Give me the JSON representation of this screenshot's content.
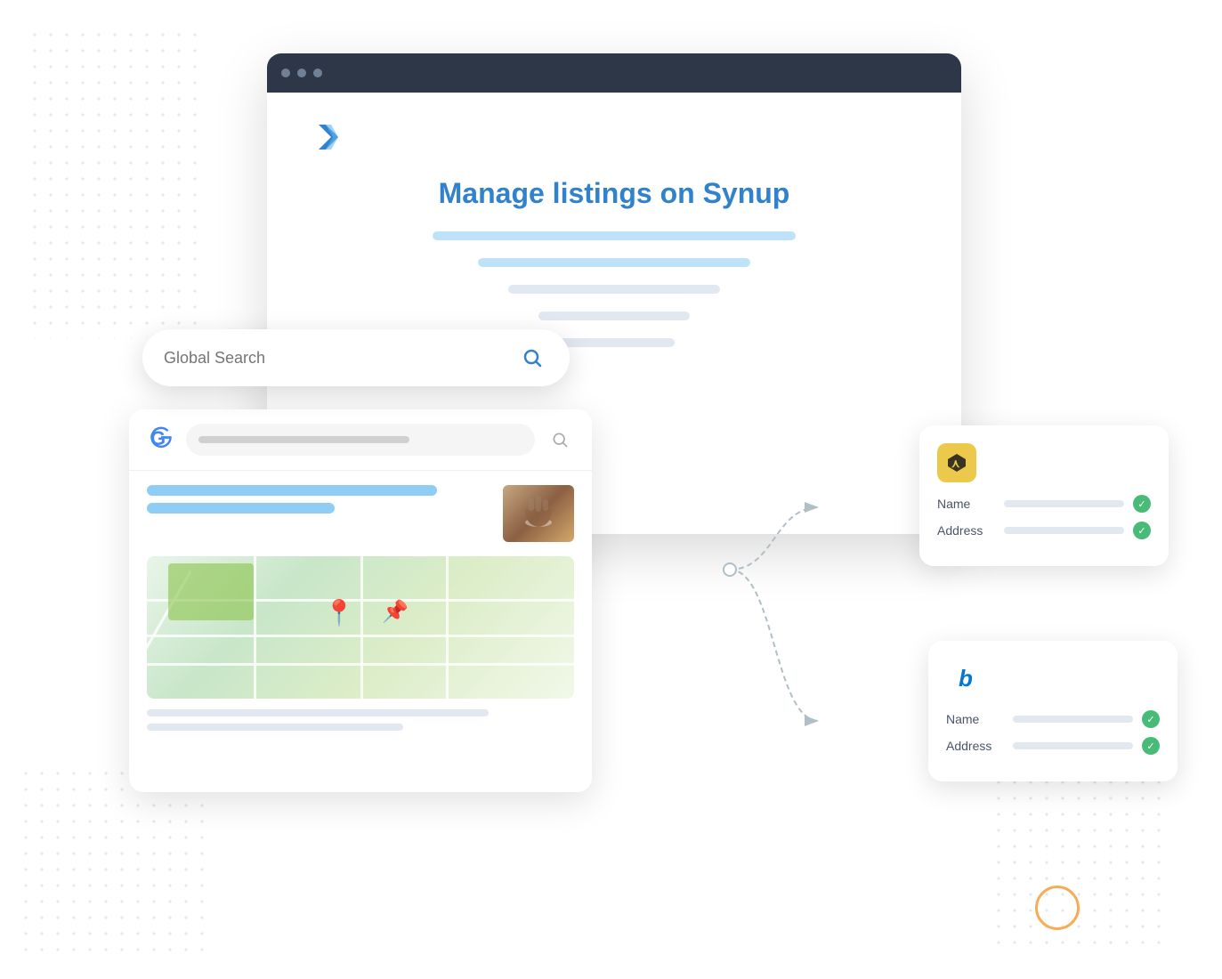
{
  "page": {
    "title": "Manage listings on Synup"
  },
  "heading": {
    "text_before": "Manage listings on ",
    "brand": "Synup",
    "full": "Manage listings on Synup"
  },
  "search": {
    "placeholder": "Global Search",
    "icon": "search"
  },
  "card1": {
    "icon_label": "yext-icon",
    "icon_bg": "yellow",
    "name_label": "Name",
    "address_label": "Address"
  },
  "card2": {
    "icon_label": "bing-icon",
    "icon_bg": "blue",
    "name_label": "Name",
    "address_label": "Address"
  },
  "connection": {
    "line_color": "#a0aec0",
    "arrow_color": "#a0aec0"
  }
}
